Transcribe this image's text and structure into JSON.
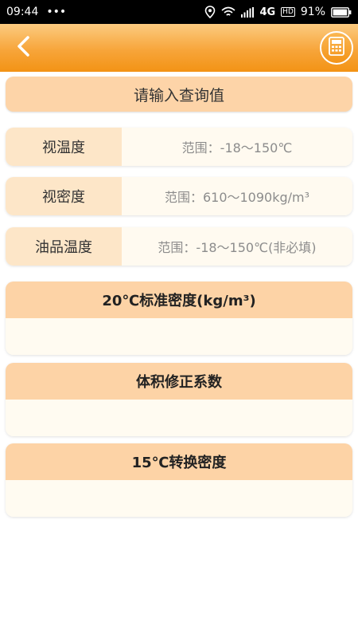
{
  "status_bar": {
    "time": "09:44",
    "dots": "•••",
    "network": "4G",
    "hd": "HD",
    "battery": "91%"
  },
  "header": {
    "back_icon": "chevron-left-icon",
    "calculator_icon": "calculator-icon"
  },
  "query_bar": {
    "label": "请输入查询值"
  },
  "inputs": [
    {
      "label": "视温度",
      "placeholder": "范围：-18～150℃"
    },
    {
      "label": "视密度",
      "placeholder": "范围：610～1090kg/m³"
    },
    {
      "label": "油品温度",
      "placeholder": "范围：-18～150℃(非必填)"
    }
  ],
  "results": [
    {
      "title": "20℃标准密度(kg/m³)",
      "value": ""
    },
    {
      "title": "体积修正系数",
      "value": ""
    },
    {
      "title": "15℃转换密度",
      "value": ""
    }
  ],
  "colors": {
    "accent": "#f39315",
    "header_light": "#fccb80",
    "label_bg": "#fde6c8",
    "card_head": "#fdd3a6"
  }
}
